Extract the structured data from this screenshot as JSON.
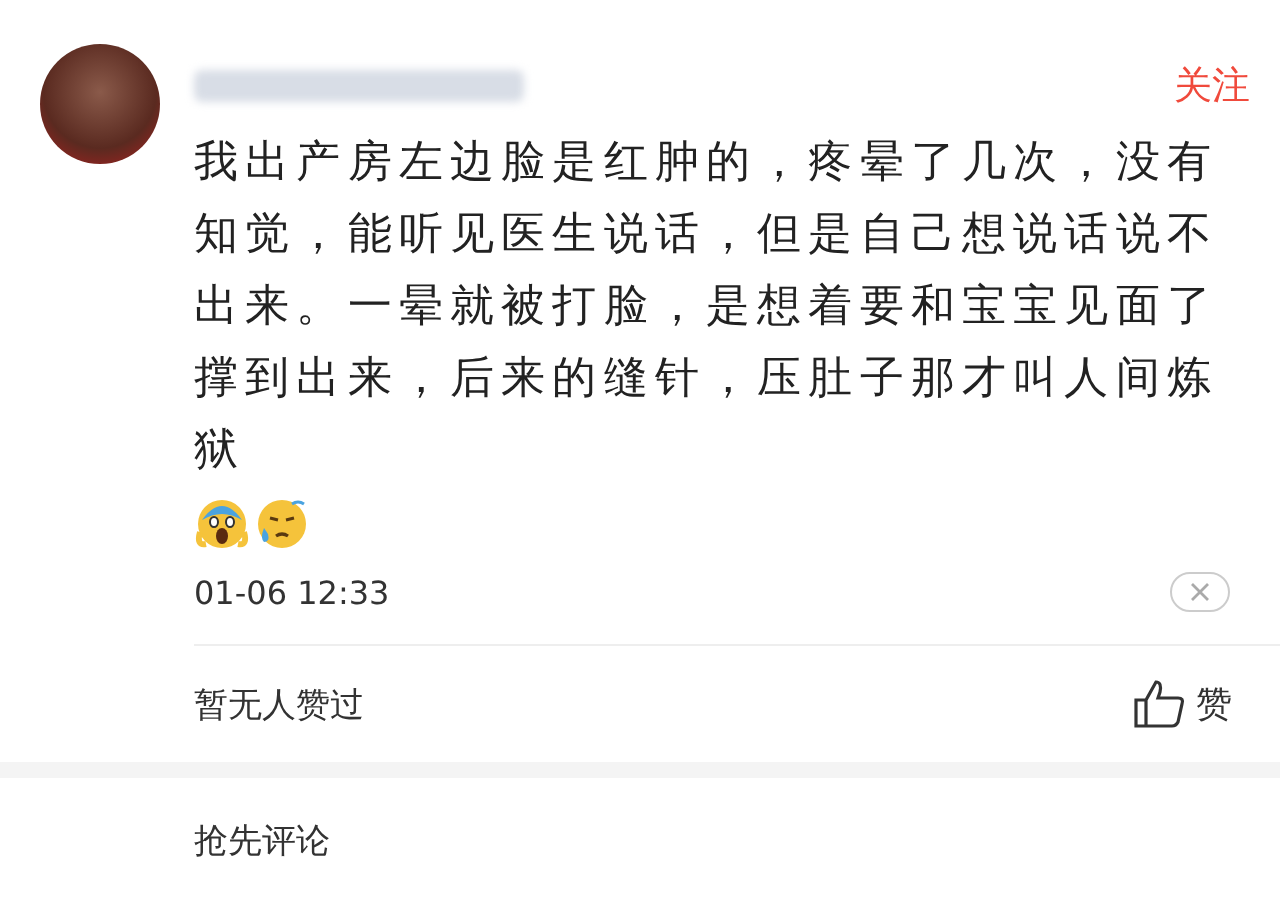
{
  "comment": {
    "follow_label": "关注",
    "text": "我出产房左边脸是红肿的，疼晕了几次，没有知觉，能听见医生说话，但是自己想说话说不出来。一晕就被打脸，是想着要和宝宝见面了撑到出来，后来的缝针，压肚子那才叫人间炼狱",
    "time": "01-06 12:33"
  },
  "likes": {
    "summary": "暂无人赞过",
    "like_label": "赞"
  },
  "reply_prompt": "抢先评论"
}
